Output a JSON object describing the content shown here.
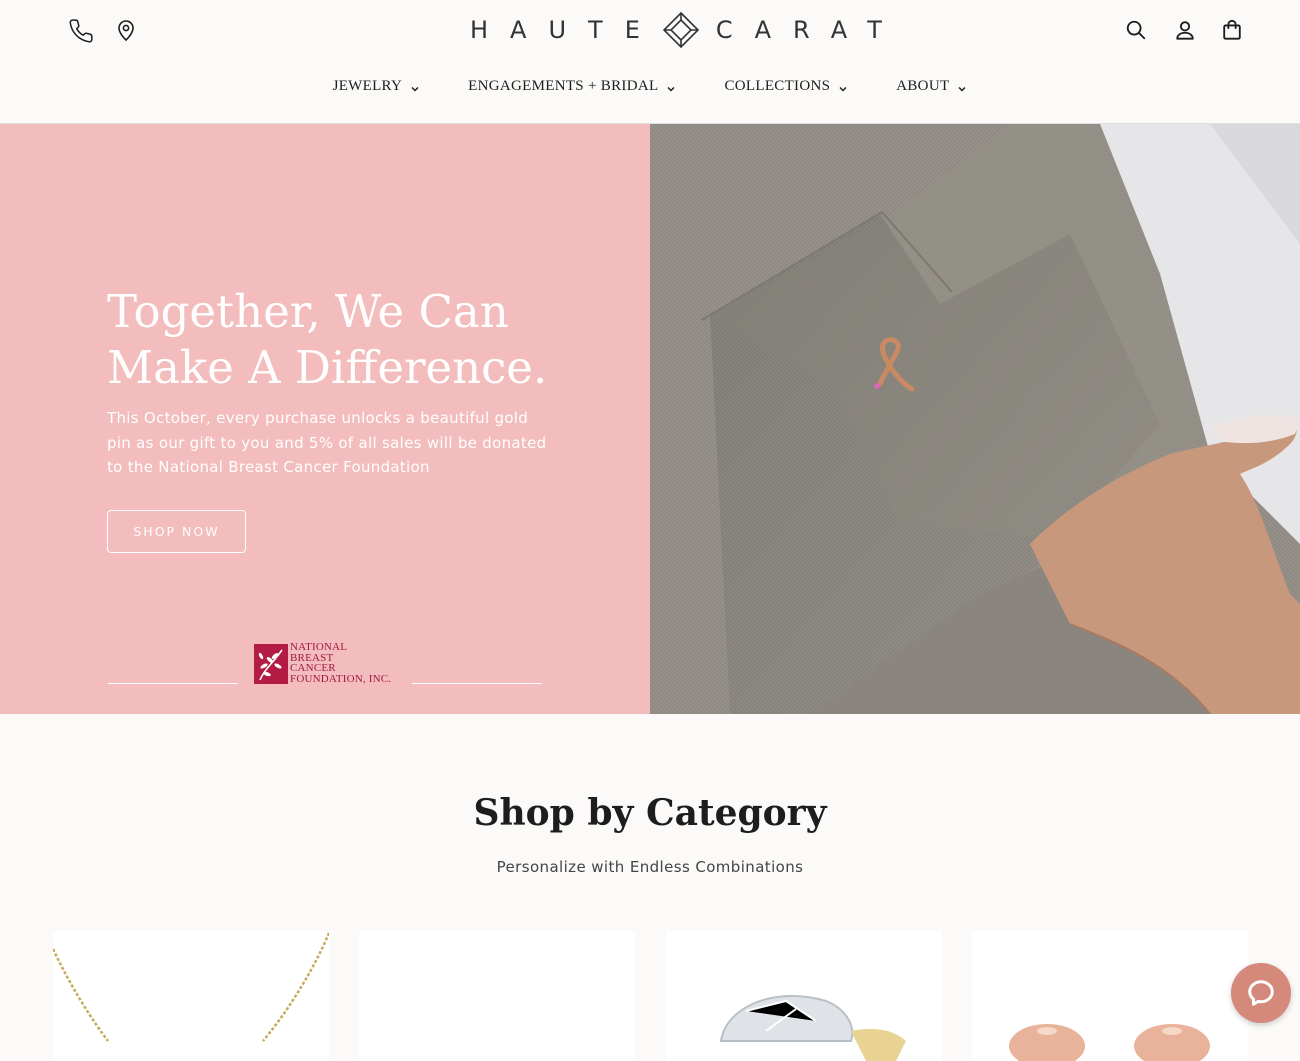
{
  "header": {
    "logo_left": "HAUTE",
    "logo_right": "CARAT",
    "icons": [
      "phone-icon",
      "location-icon",
      "search-icon",
      "account-icon",
      "bag-icon"
    ]
  },
  "nav": {
    "items": [
      {
        "label": "JEWELRY"
      },
      {
        "label": "ENGAGEMENTS + BRIDAL"
      },
      {
        "label": "COLLECTIONS"
      },
      {
        "label": "ABOUT"
      }
    ]
  },
  "hero": {
    "title_line1": "Together, We Can",
    "title_line2": "Make A Difference.",
    "body": "This October, every purchase unlocks a beautiful gold pin as our gift to you and 5% of all sales will be donated to the National Breast Cancer Foundation",
    "cta": "SHOP NOW",
    "partner": {
      "line1": "NATIONAL",
      "line2": "BREAST",
      "line3": "CANCER",
      "line4": "FOUNDATION, INC."
    },
    "background_color": "#f3bcbd"
  },
  "section": {
    "title": "Shop by Category",
    "subtitle": "Personalize with Endless Combinations"
  },
  "colors": {
    "accent": "#d4897a",
    "partner_red": "#b31b45"
  }
}
